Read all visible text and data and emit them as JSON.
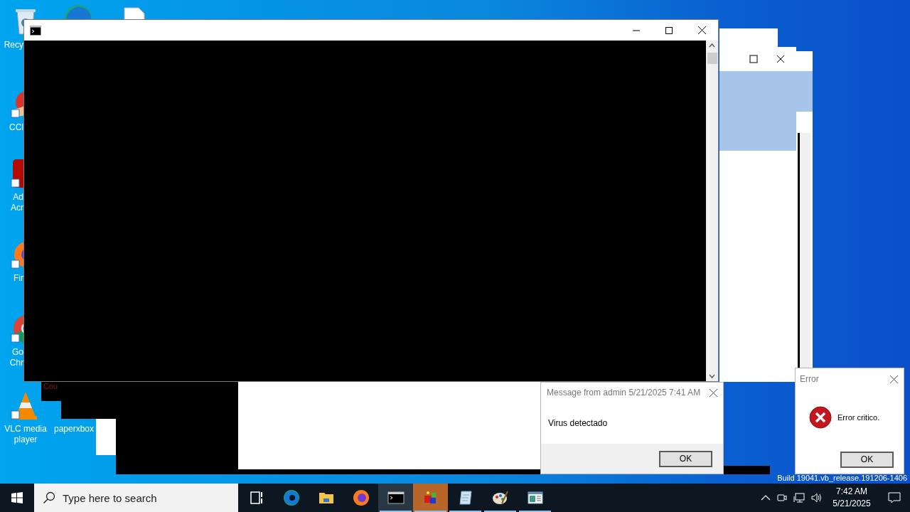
{
  "desktop_icons": [
    {
      "kind": "recycle-bin",
      "lines": [
        "Recy"
      ]
    },
    {
      "kind": "edge"
    },
    {
      "kind": "document"
    },
    {
      "kind": "ccleaner",
      "lines": [
        "CCl"
      ]
    },
    {
      "kind": "acrobat",
      "lines": [
        "Ad",
        "Acr"
      ]
    },
    {
      "kind": "firefox",
      "lines": [
        "Fir"
      ]
    },
    {
      "kind": "chrome",
      "lines": [
        "Go",
        "Chr"
      ]
    },
    {
      "kind": "vlc",
      "lines": [
        "VLC media",
        "player"
      ]
    },
    {
      "lines": [
        "paperxbox"
      ]
    }
  ],
  "small_window": {
    "text": "Cou"
  },
  "message_box": {
    "title": "Message from admin 5/21/2025 7:41 AM",
    "message": "Virus detectado",
    "button": "OK"
  },
  "error_dialog": {
    "title": "Error",
    "message": "Error critico.",
    "button": "OK"
  },
  "build_info": "Build 19041.vb_release.191206-1406",
  "taskbar": {
    "search": {
      "placeholder": "Type here to search"
    },
    "apps": [
      {
        "kind": "task-view",
        "running": false,
        "selected": false,
        "attention": false
      },
      {
        "kind": "edge",
        "running": false,
        "selected": false,
        "attention": false
      },
      {
        "kind": "explorer",
        "running": false,
        "selected": false,
        "attention": false
      },
      {
        "kind": "firefox",
        "running": false,
        "selected": false,
        "attention": false
      },
      {
        "kind": "console",
        "running": true,
        "selected": true,
        "attention": false
      },
      {
        "kind": "cubes",
        "running": true,
        "selected": false,
        "attention": true
      },
      {
        "kind": "notepad",
        "running": true,
        "selected": false,
        "attention": false
      },
      {
        "kind": "paint",
        "running": true,
        "selected": false,
        "attention": false
      },
      {
        "kind": "window",
        "running": true,
        "selected": false,
        "attention": false
      }
    ],
    "clock": {
      "time": "7:42 AM",
      "date": "5/21/2025"
    }
  }
}
